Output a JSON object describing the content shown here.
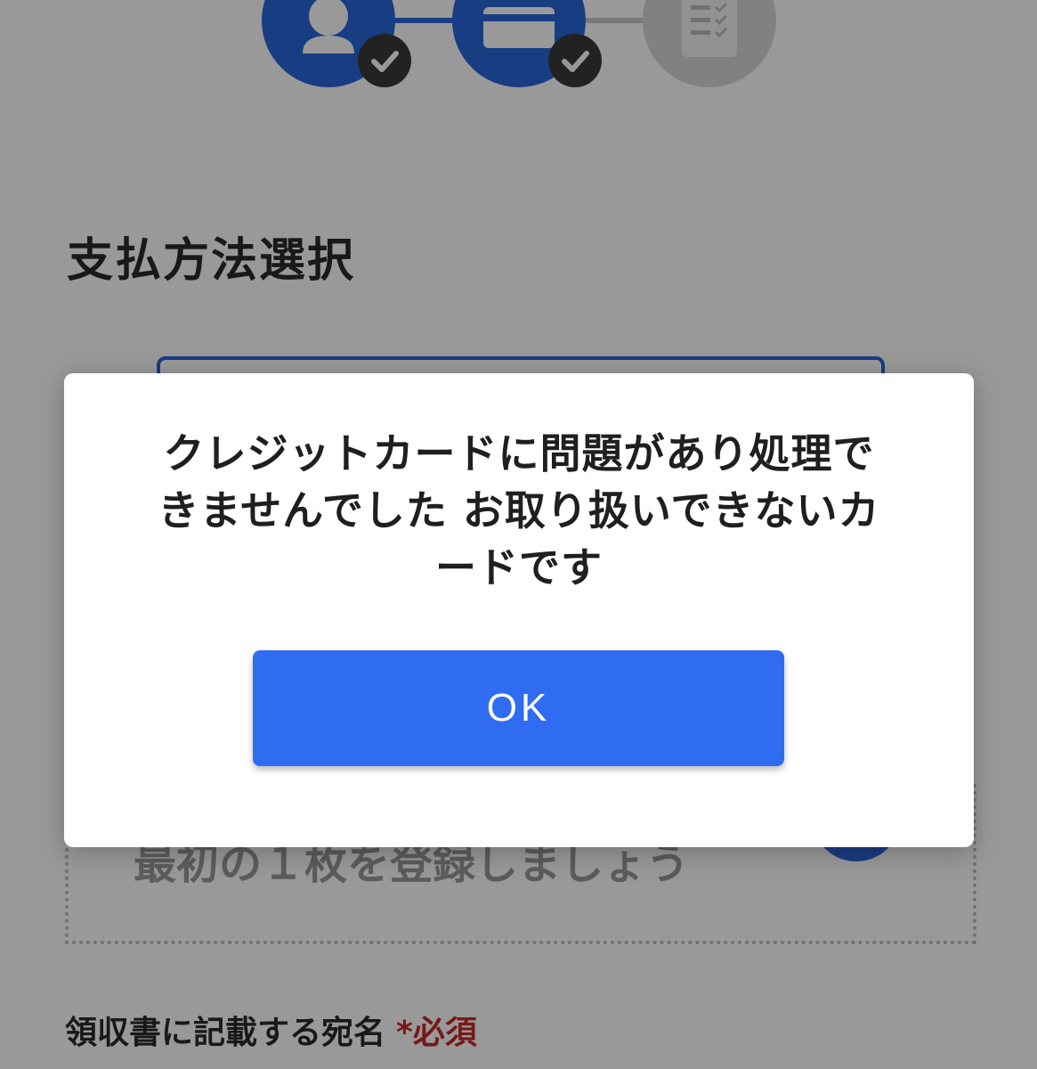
{
  "stepper": {
    "steps": [
      {
        "icon": "user-icon",
        "status": "completed",
        "badge_icon": "check-icon"
      },
      {
        "icon": "credit-card-icon",
        "status": "completed",
        "badge_icon": "check-icon"
      },
      {
        "icon": "checklist-icon",
        "status": "pending"
      }
    ]
  },
  "main": {
    "section_title": "支払方法選択",
    "add_card_prompt": "最初の１枚を登録しましょう",
    "receipt_label": "領収書に記載する宛名",
    "required_mark": "*必須"
  },
  "dialog": {
    "message": "クレジットカードに問題があり処理できませんでした お取り扱いできないカードです",
    "ok_label": "OK"
  },
  "colors": {
    "primary": "#2f6cf2",
    "step_active": "#2a66d9",
    "required": "#c62828",
    "overlay": "rgba(0,0,0,0.40)"
  }
}
